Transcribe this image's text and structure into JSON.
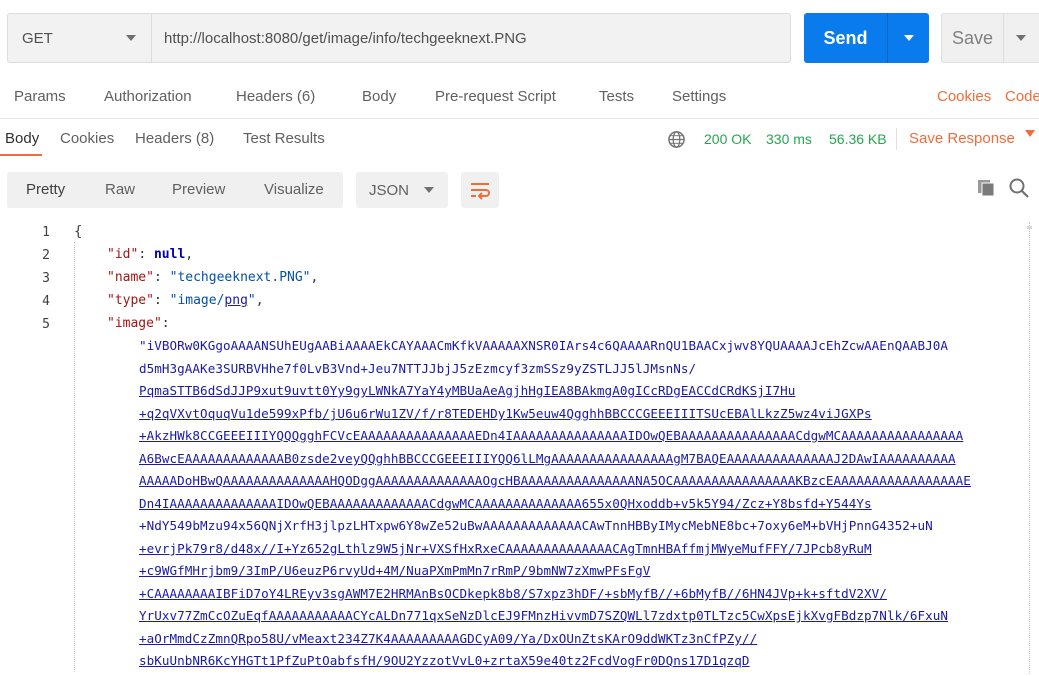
{
  "request": {
    "method": "GET",
    "url": "http://localhost:8080/get/image/info/techgeeknext.PNG",
    "send_label": "Send",
    "save_label": "Save"
  },
  "request_tabs": {
    "params": "Params",
    "authorization": "Authorization",
    "headers": "Headers",
    "headers_count": "(6)",
    "body": "Body",
    "pre_request": "Pre-request Script",
    "tests": "Tests",
    "settings": "Settings",
    "cookies": "Cookies",
    "code": "Code"
  },
  "response_tabs": {
    "body": "Body",
    "cookies": "Cookies",
    "headers": "Headers",
    "headers_count": "(8)",
    "test_results": "Test Results"
  },
  "status": {
    "code": "200 OK",
    "time": "330 ms",
    "size": "56.36 KB",
    "save_response": "Save Response"
  },
  "viewer": {
    "modes": [
      "Pretty",
      "Raw",
      "Preview",
      "Visualize"
    ],
    "format": "JSON"
  },
  "icons": {
    "globe": "globe-icon",
    "wrap": "wrap-lines-icon",
    "copy": "copy-icon",
    "search": "search-icon"
  },
  "colors": {
    "send": "#097bed",
    "orange": "#f26b3a",
    "green": "#26a650"
  },
  "json_body": {
    "line_numbers": [
      "1",
      "2",
      "3",
      "4",
      "5"
    ],
    "open_brace": "{",
    "id_key": "\"id\"",
    "id_value": "null",
    "name_key": "\"name\"",
    "name_value": "\"techgeeknext.PNG\"",
    "type_key": "\"type\"",
    "type_value_a": "\"image/",
    "type_value_b": "png",
    "type_value_c": "\"",
    "image_key": "\"image\"",
    "image_lines": [
      "\"iVBORw0KGgoAAAANSUhEUgAABiAAAAEkCAYAAACmKfkVAAAAAXNSR0IArs4c6QAAAARnQU1BAACxjwv8YQUAAAAJcEhZcwAAEnQAABJ0A",
      "d5mH3gAAKe3SURBVHhe7f0LvB3Vnd+Jeu7NTTJJbjJ5zEzmcyf3zmSSz9yZSTLJJ5lJMsnNs/",
      "PqmaSTTB6dSdJJP9xut9uvtt0Yy9gyLWNkA7YaY4yMBUaAeAgjhHgIEA8BAkmgA0gICcRDgEACCdCRdKSjI7Hu",
      "+q2qVXvtOquqVu1de599xPfb/jU6u6rWu1ZV/f/r8TEDEHDy1Kw5euw4QgghhBBCCCGEEEIIITSUcEBAlLkzZ5wz4viJGXPs",
      "+AkzHWk8CCGEEEIIIYQQQgghFCVcEAAAAAAAAAAAAAAAEDn4IAAAAAAAAAAAAAAAIDOwQEBAAAAAAAAAAAAAAACdgwMCAAAAAAAAAAAAAAAA",
      "A6BwcEAAAAAAAAAAAAAB0zsde2veyQQghhBBCCCGEEEIIIYQQ6lLMgAAAAAAAAAAAAAAAAgM7BAQEAAAAAAAAAAAAAAJ2DAwIAAAAAAAAAA",
      "AAAAADoHBwQAAAAAAAAAAAAAAHQODggAAAAAAAAAAAAAAOgcHBAAAAAAAAAAAAAAANA5OCAAAAAAAAAAAAAAAAKBzcEAAAAAAAAAAAAAAAAAE",
      "Dn4IAAAAAAAAAAAAAAIDOwQEBAAAAAAAAAAAAACdgwMCAAAAAAAAAAAAAA655x0QHxoddb+v5k5Y94/Zcz+Y8bsfd+Y544Ys",
      "+NdY549bMzu94x56QNjXrfH3jlpzLHTxpw6Y8wZe52uBwAAAAAAAAAAAAACAwTnnHBByIMycMebNE8bc+7oxy6eM+bVHjPnnG4352+uN",
      "+evrjPk79r8/d48x//I+Yz652gLthlz9W5jNr+VXSfHxRxeCAAAAAAAAAAAAAACAgTmnHBAffmjMWyeMufFFY/7JPcb8yRuM",
      "+c9WGfMHrjbm9/3ImP/U6euzP6rvyUd+4M/NuaPXmPmMn7rRmP/9bmNW7zXmwPFsFgV",
      "+CAAAAAAAAIBFiD7oY4LREyv3sgAWM7E2HRMAnBsOCDkepk8b8/S7xpz3hDF/+sbMyfB//+6bMyfB//6HN4JVp+k+sftdV2XV/",
      "YrUxv77ZmCcOZuEqfAAAAAAAAAAACYcALDn771qxSeNzDlcEJ9FMnzHivvmD7SZQWLl7zdxtp0TLTzc5CwXpsEjkXvgFBdzp7Nlk/6FxuN",
      "+aOrMmdCzZmnQRpo58U/vMeaxt234Z7K4AAAAAAAAAGDCyA09/Ya/DxOUnZtsKArO9ddWKTz3nCfPZy//",
      "sbKuUnbNR6KcYHGTt1PfZuPtOabfsfH/9OU2YzzotVvL0+zrtaX59e40tz2FcdVogFr0DQns17D1qzqD"
    ]
  }
}
